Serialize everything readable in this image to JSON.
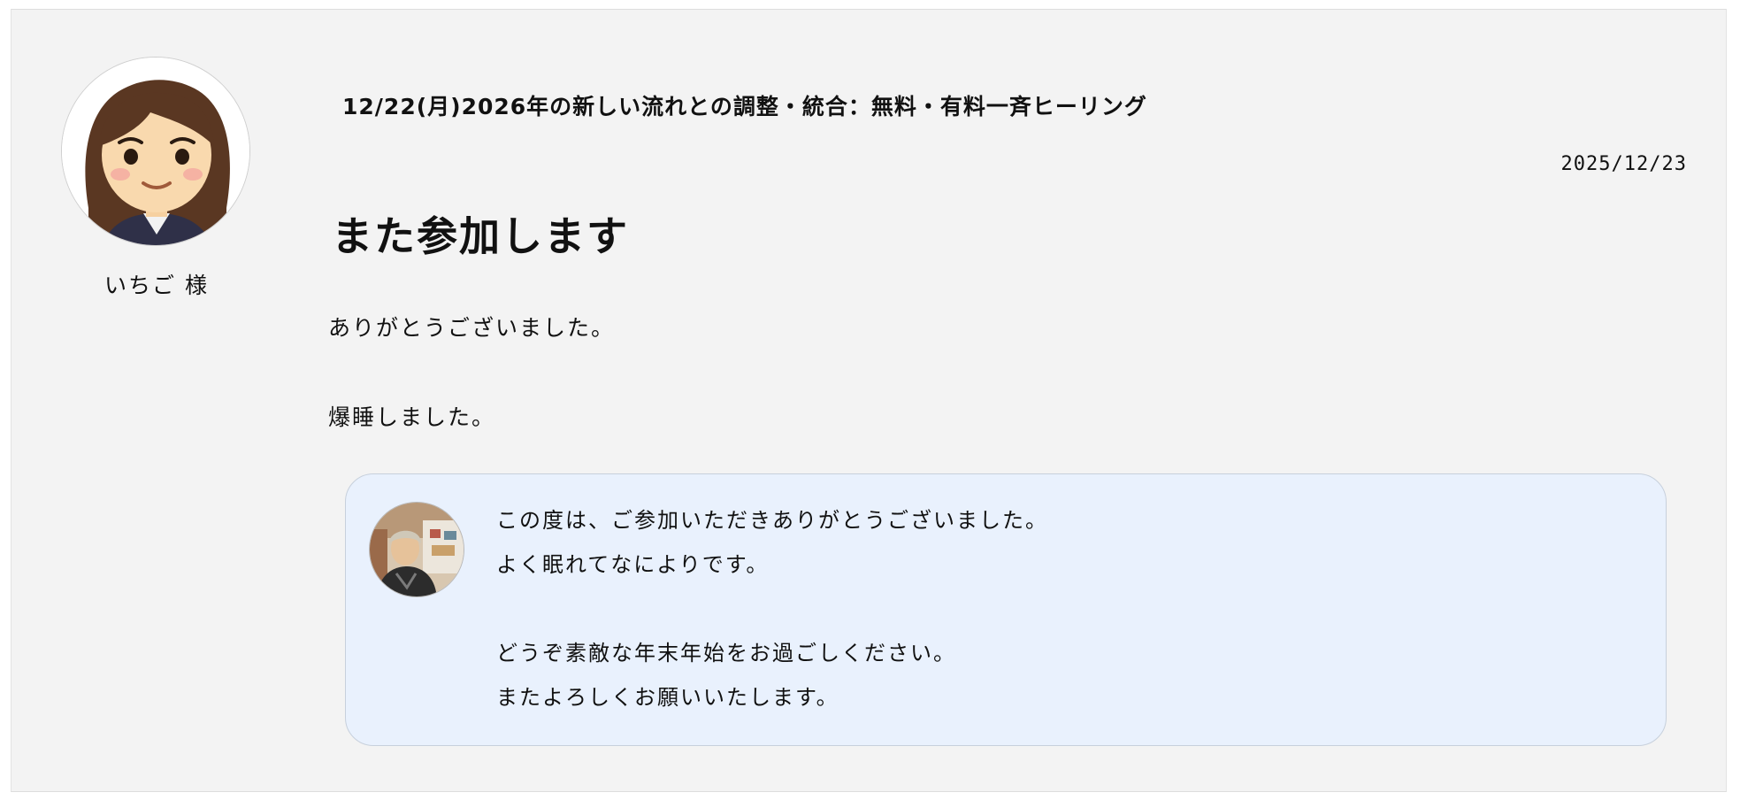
{
  "review": {
    "author": "いちご 様",
    "event_title": "12/22(月)2026年の新しい流れとの調整・統合：無料・有料一斉ヒーリング",
    "date": "2025/12/23",
    "title": "また参加します",
    "body": [
      "ありがとうございました。",
      "爆睡しました。"
    ]
  },
  "reply": {
    "lines": [
      "この度は、ご参加いただきありがとうございました。",
      "よく眠れてなによりです。",
      "",
      "どうぞ素敵な年末年始をお過ごしください。",
      "またよろしくお願いいたします。"
    ]
  },
  "icons": {
    "user_avatar": "avatar-girl-illustration-icon",
    "reply_avatar": "host-photo-avatar-icon"
  },
  "colors": {
    "card_background": "#f3f3f3",
    "reply_background": "#e9f1fd",
    "text": "#111111"
  }
}
